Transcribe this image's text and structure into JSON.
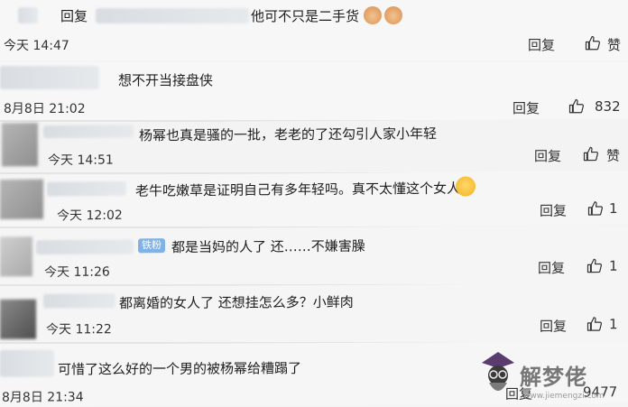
{
  "comments": [
    {
      "reply_label": "回复",
      "text_tail": "他可不只是二手货",
      "time": "今天 14:47",
      "action_reply": "回复",
      "like_label": "赞"
    },
    {
      "text": "想不开当接盘侠",
      "time": "8月8日 21:02",
      "action_reply": "回复",
      "like_count": "832"
    },
    {
      "text": "杨幂也真是骚的一批，老老的了还勾引人家小年轻",
      "time": "今天 14:51",
      "action_reply": "回复",
      "like_label": "赞"
    },
    {
      "text": "老牛吃嫩草是证明自己有多年轻吗。真不太懂这个女人",
      "time": "今天 12:02",
      "action_reply": "回复",
      "like_count": "1"
    },
    {
      "badge": "铁粉",
      "text": "都是当妈的人了 还……不嫌害臊",
      "time": "今天 11:26",
      "action_reply": "回复",
      "like_count": "1"
    },
    {
      "text": "都离婚的女人了 还想挂怎么多？小鲜肉",
      "time": "今天 11:22",
      "action_reply": "回复",
      "like_count": "1"
    },
    {
      "text": "可惜了这么好的一个男的被杨幂给糟蹋了",
      "time": "8月8日 21:34",
      "action_reply": "回复",
      "like_count": "9477"
    }
  ],
  "watermark": {
    "text": "解梦佬",
    "url": "www.jiemengzi.com"
  },
  "colors": {
    "badge": "#7fb3e8",
    "background": "#f4f4f4"
  }
}
